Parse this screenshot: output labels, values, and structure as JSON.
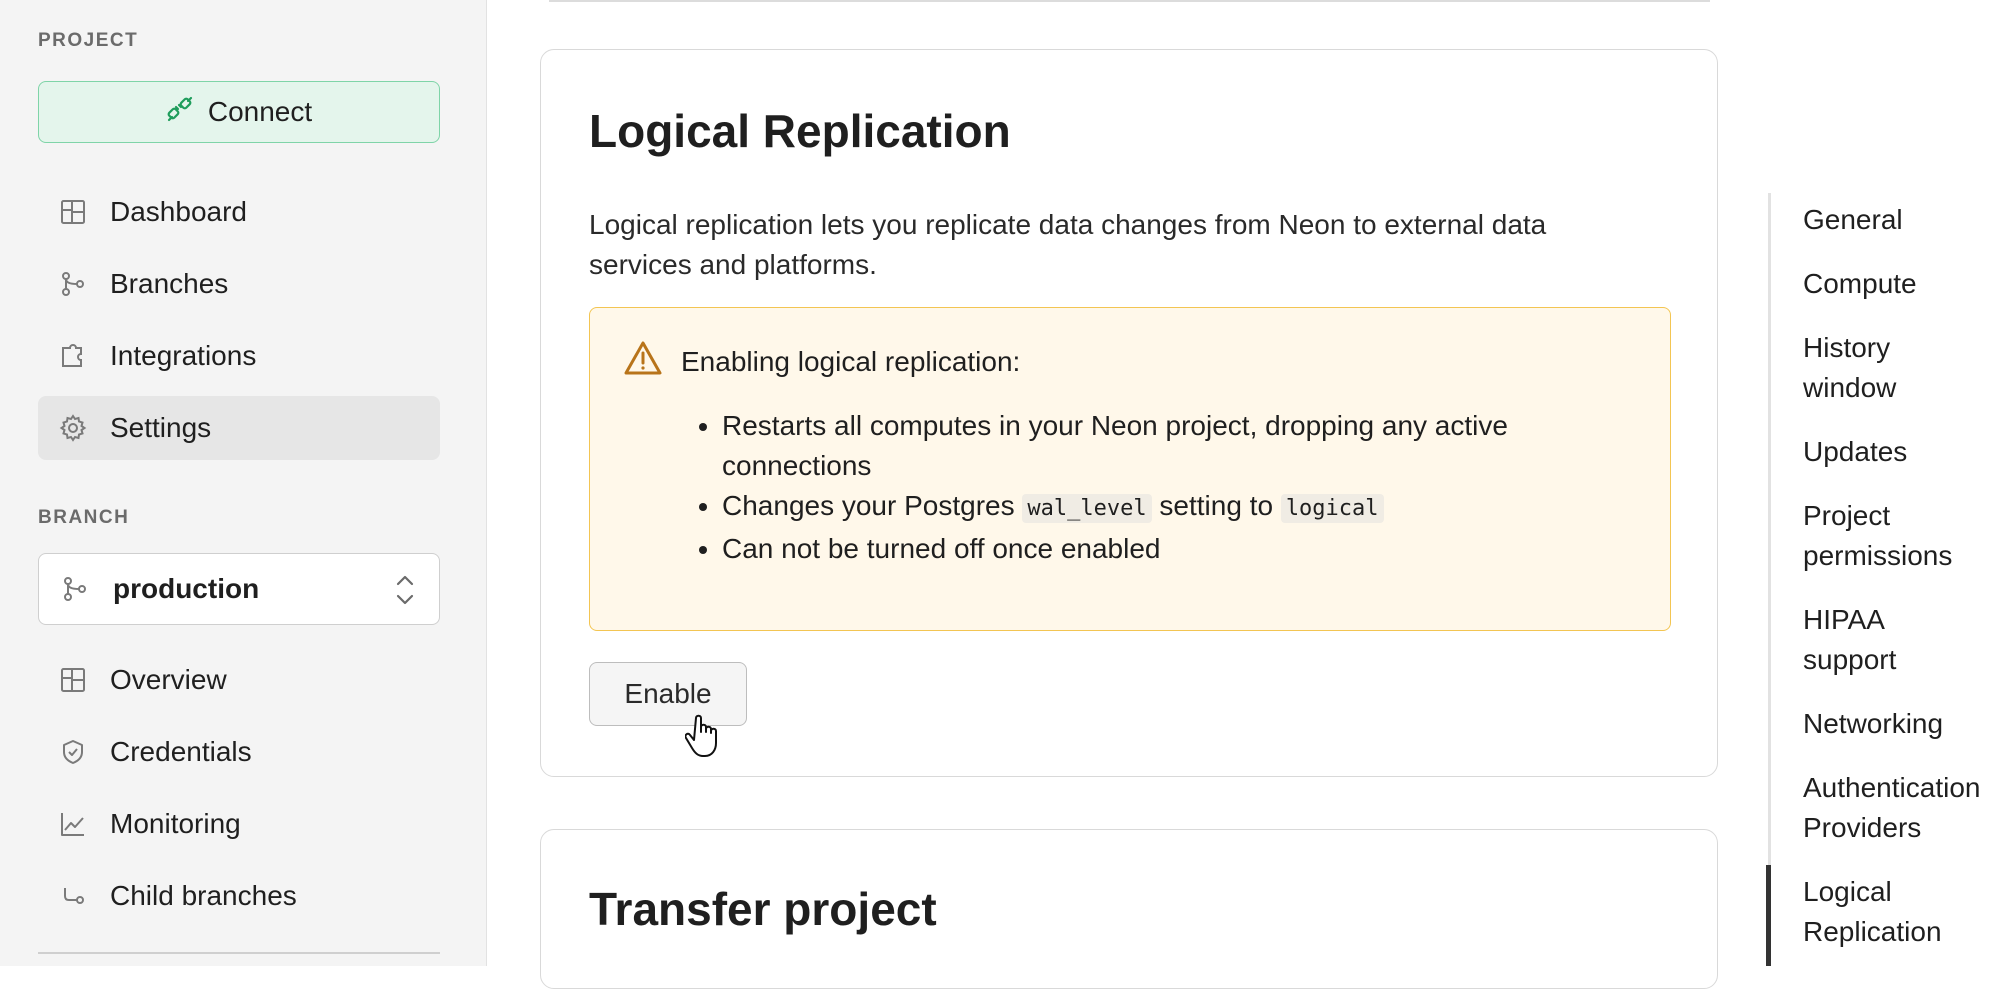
{
  "sidebar": {
    "project_label": "PROJECT",
    "connect_label": "Connect",
    "project_items": [
      {
        "label": "Dashboard",
        "icon": "dashboard-icon"
      },
      {
        "label": "Branches",
        "icon": "branch-icon"
      },
      {
        "label": "Integrations",
        "icon": "puzzle-icon"
      },
      {
        "label": "Settings",
        "icon": "gear-icon",
        "active": true
      }
    ],
    "branch_label": "BRANCH",
    "branch_selected": "production",
    "branch_items": [
      {
        "label": "Overview",
        "icon": "dashboard-icon"
      },
      {
        "label": "Credentials",
        "icon": "shield-icon"
      },
      {
        "label": "Monitoring",
        "icon": "chart-icon"
      },
      {
        "label": "Child branches",
        "icon": "child-branch-icon"
      }
    ]
  },
  "main": {
    "logical_replication": {
      "title": "Logical Replication",
      "description": "Logical replication lets you replicate data changes from Neon to external data services and platforms.",
      "warning_title": "Enabling logical replication:",
      "bullet1": "Restarts all computes in your Neon project, dropping any active connections",
      "bullet2_prefix": "Changes your Postgres",
      "bullet2_code1": "wal_level",
      "bullet2_mid": "setting to",
      "bullet2_code2": "logical",
      "bullet3": "Can not be turned off once enabled",
      "enable_label": "Enable"
    },
    "transfer": {
      "title": "Transfer project"
    }
  },
  "toc": {
    "items": [
      "General",
      "Compute",
      "History window",
      "Updates",
      "Project permissions",
      "HIPAA support",
      "Networking",
      "Authentication Providers",
      "Logical Replication"
    ],
    "active": "Logical Replication"
  },
  "colors": {
    "connect_bg": "#e4f5ec",
    "connect_border": "#7fd4a8",
    "warning_bg": "#fff8ea",
    "warning_border": "#f3c552",
    "warning_icon": "#b8741a"
  }
}
